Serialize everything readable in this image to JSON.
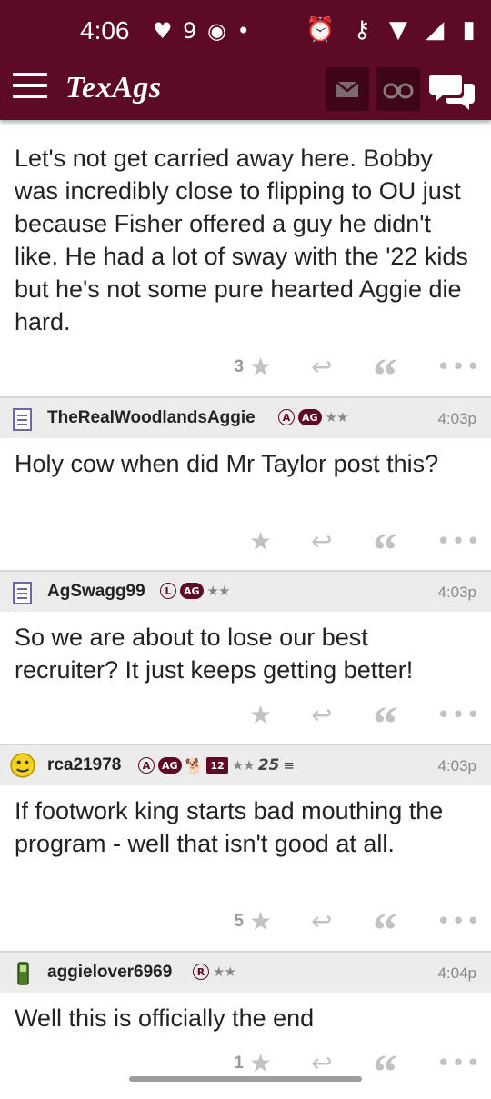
{
  "status_bar": {
    "time": "4:06",
    "left_icons": "♥ 9 ◉ •",
    "right_icons": "⏰ ⚷ ▼ ◢ ▮"
  },
  "app_bar": {
    "logo": "TexAgs"
  },
  "posts": [
    {
      "body": "Let's not get carried away here. Bobby was incredibly close to flipping to OU just because Fisher offered a guy he didn't like. He had a lot of sway with the '22 kids but he's not some pure hearted Aggie die hard.",
      "star_count": "3"
    },
    {
      "username": "TheRealWoodlandsAggie",
      "badges": [
        "A",
        "AG"
      ],
      "stars": "★★",
      "time": "4:03p",
      "body": "Holy cow when did Mr Taylor post this?",
      "star_count": ""
    },
    {
      "username": "AgSwagg99",
      "badges": [
        "L",
        "AG"
      ],
      "stars": "★★",
      "time": "4:03p",
      "body": "So we are about to lose our best recruiter? It just keeps getting better!",
      "star_count": ""
    },
    {
      "username": "rca21978",
      "badges": [
        "A",
        "AG",
        "12"
      ],
      "stars": "★★",
      "extra_badge": "25",
      "time": "4:03p",
      "body": "If footwork king starts bad mouthing the program - well that isn't good at all.",
      "star_count": "5"
    },
    {
      "username": "aggielover6969",
      "badges": [
        "R"
      ],
      "stars": "★★",
      "time": "4:04p",
      "body": "Well this is officially the end",
      "star_count": "1"
    }
  ]
}
